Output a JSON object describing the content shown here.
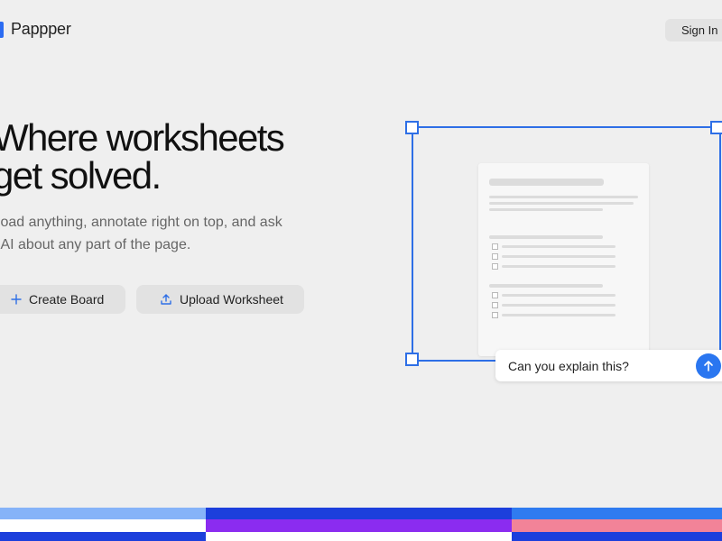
{
  "app": {
    "name": "Pappper"
  },
  "header": {
    "signin_label": "Sign In"
  },
  "hero": {
    "headline": [
      "Where worksheets",
      "get solved."
    ],
    "subtitle": [
      "pload anything, annotate right on top, and ask",
      "e AI about any part of the page."
    ],
    "buttons": {
      "create": "Create Board",
      "upload": "Upload Worksheet"
    }
  },
  "preview": {
    "prompt_text": "Can you explain this?",
    "icons": {
      "send": "arrow-up-icon",
      "create": "plus-icon",
      "upload": "upload-icon"
    }
  },
  "colors": {
    "accent": "#2e6fe6",
    "stripe_light_blue": "#86b3f8",
    "stripe_blue": "#1c3fdc",
    "stripe_purple": "#8b2cf0",
    "stripe_sky": "#2f7bf0",
    "stripe_pink": "#f28398"
  }
}
